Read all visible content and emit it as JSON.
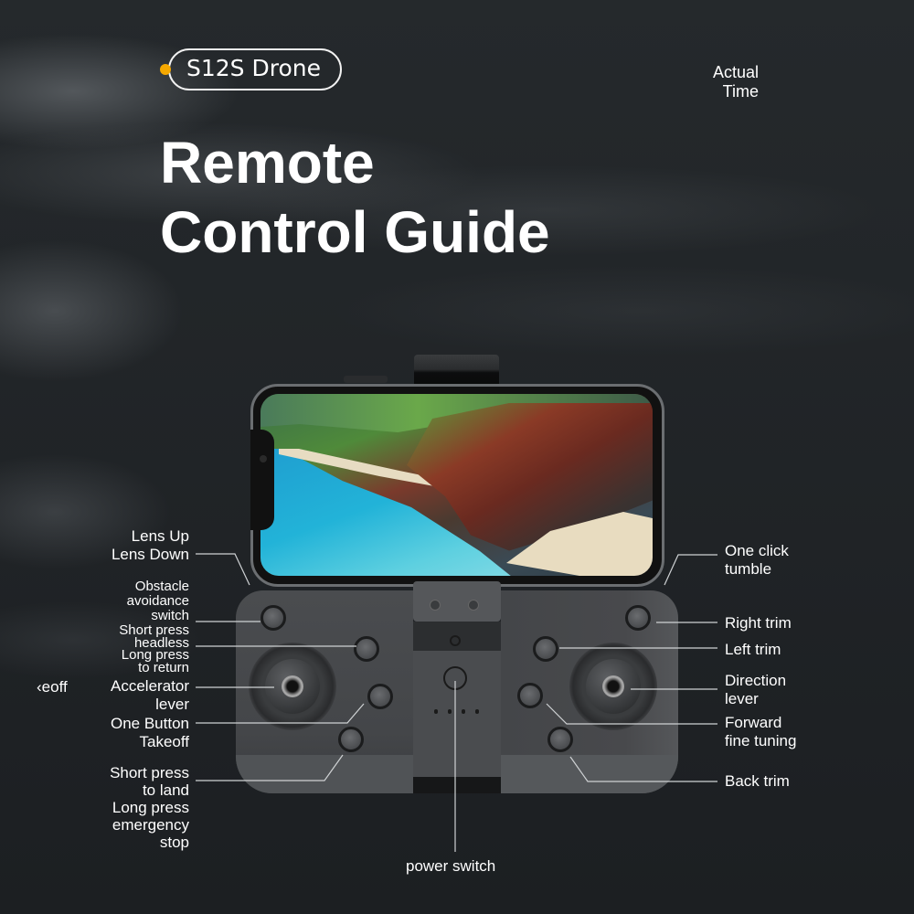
{
  "badge": {
    "label": "S12S Drone",
    "dot_color": "#f5a800"
  },
  "corner_note": {
    "line1": "Actual",
    "line2": "Time"
  },
  "title": {
    "line1": "Remote",
    "line2": "Control Guide"
  },
  "left_labels": {
    "lens": [
      "Lens Up",
      "Lens Down"
    ],
    "obstacle": [
      "Obstacle",
      "avoidance",
      "switch"
    ],
    "headless": [
      "Short press",
      "headless",
      "Long press",
      "to return"
    ],
    "accelerator": [
      "Accelerator",
      "lever"
    ],
    "takeoff": [
      "One Button",
      "Takeoff"
    ],
    "land": [
      "Short press",
      "to land",
      "Long press",
      "emergency",
      "stop"
    ],
    "cut_off_fragment": "‹eoff"
  },
  "right_labels": {
    "tumble": [
      "One click",
      "tumble"
    ],
    "right_trim": "Right trim",
    "left_trim": "Left trim",
    "direction": [
      "Direction",
      "lever"
    ],
    "forward": [
      "Forward",
      "fine tuning"
    ],
    "back_trim": "Back trim"
  },
  "bottom_label": "power switch"
}
